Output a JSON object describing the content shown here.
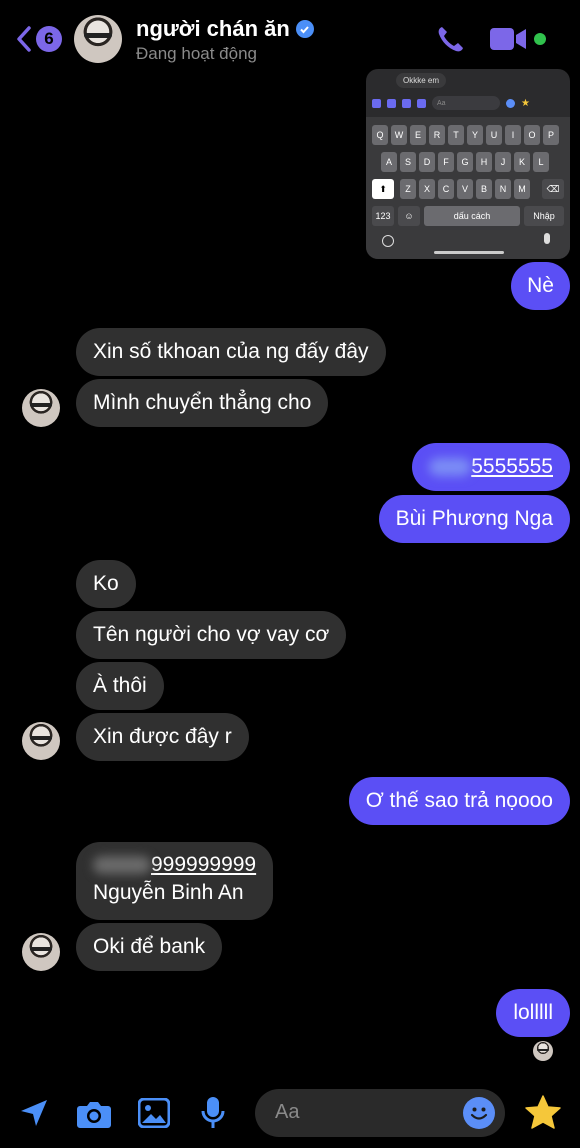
{
  "header": {
    "unread_count": "6",
    "contact_name": "người chán ăn",
    "status": "Đang hoạt động",
    "icons": [
      "back-chevron-icon",
      "verified-badge-icon",
      "phone-icon",
      "video-camera-icon",
      "online-dot-icon"
    ]
  },
  "keyboard_screenshot": {
    "bubble_text": "Okkke em",
    "input_placeholder": "Aa",
    "row1": [
      "Q",
      "W",
      "E",
      "R",
      "T",
      "Y",
      "U",
      "I",
      "O",
      "P"
    ],
    "row2": [
      "A",
      "S",
      "D",
      "F",
      "G",
      "H",
      "J",
      "K",
      "L"
    ],
    "row3": [
      "Z",
      "X",
      "C",
      "V",
      "B",
      "N",
      "M"
    ],
    "key_123": "123",
    "key_space": "dấu cách",
    "key_return": "Nhập"
  },
  "messages": {
    "m1": "Nè",
    "m2": "Xin số tkhoan của ng đấy đây",
    "m3": "Mình chuyển thẳng cho",
    "m4": "5555555",
    "m5": "Bùi Phương Nga",
    "m6": "Ko",
    "m7": "Tên người cho vợ vay cơ",
    "m8": "À thôi",
    "m9": "Xin được đây r",
    "m10": "Ơ thế sao trả nọooo",
    "m11_line1": "999999999",
    "m11_line2": "Nguyễn Binh An",
    "m12": "Oki để bank",
    "m13": "lolllll"
  },
  "composer": {
    "placeholder": "Aa",
    "icons": [
      "location-arrow-icon",
      "camera-icon",
      "image-icon",
      "microphone-icon",
      "emoji-icon",
      "star-sticker-icon"
    ]
  },
  "colors": {
    "accent": "#5b4ff5",
    "incoming_bubble": "#303030",
    "icon_purple": "#7c67e8",
    "icon_blue": "#4b8ff7"
  }
}
